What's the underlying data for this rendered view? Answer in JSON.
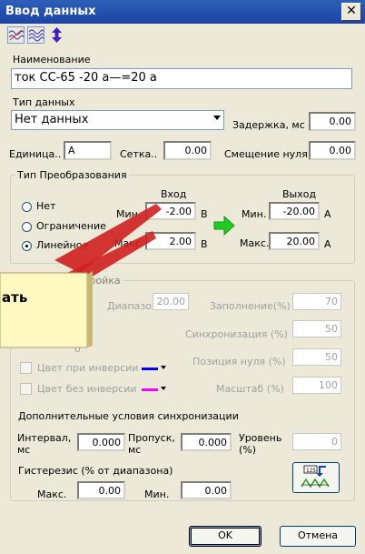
{
  "window": {
    "title": "Ввод данных",
    "close_glyph": "✕"
  },
  "toolbar": {
    "icons": [
      "wave-icon",
      "wave-stack-icon",
      "updown-arrows-icon"
    ]
  },
  "name_section": {
    "label": "Наименование",
    "value": "ток СС-65  -20 а—=20 а"
  },
  "data_type": {
    "label": "Тип данных",
    "value": "Нет данных"
  },
  "delay": {
    "label": "Задержка, мс",
    "value": "0.00"
  },
  "unit": {
    "label": "Единица..",
    "value": "А"
  },
  "grid": {
    "label": "Сетка..",
    "value": "0.00"
  },
  "zero_offset": {
    "label": "Смещение нуля",
    "value": "0.00"
  },
  "conversion": {
    "title": "Тип Преобразования",
    "options": [
      {
        "label": "Нет",
        "selected": false
      },
      {
        "label": "Ограничение",
        "selected": false
      },
      {
        "label": "Линейное",
        "selected": true
      }
    ],
    "input_header": "Вход",
    "output_header": "Выход",
    "min_label": "Мин.",
    "max_label": "Макс.",
    "in_min": "-2.00",
    "in_max": "2.00",
    "in_unit": "В",
    "out_min": "-20.00",
    "out_max": "20.00",
    "out_unit": "А"
  },
  "tooltip": {
    "text": "ать"
  },
  "settings": {
    "title": "настройка",
    "range_label": "Диапазон.",
    "range_value": "20.00",
    "fill_label": "Заполнение(%)",
    "fill_value": "70",
    "sync_label": "Синхронизация (%)",
    "sync_value": "50",
    "zero_pos_label": "Позиция нуля (%)",
    "zero_pos_value": "50",
    "scale_label": "Масштаб (%)",
    "scale_value": "100",
    "inv_color_label": "Цвет при инверсии",
    "inv_color": "#0000ff",
    "noinv_color_label": "Цвет без инверсии",
    "noinv_color": "#ff00ff",
    "partial_1": "ия",
    "partial_2": "б",
    "extra_title": "Дополнительные условия синхронизации",
    "interval_label_1": "Интервал,",
    "interval_label_2": "мс",
    "interval_value": "0.000",
    "skip_label_1": "Пропуск,",
    "skip_label_2": "мс",
    "skip_value": "0.000",
    "level_label_1": "Уровень",
    "level_label_2": "(%)",
    "level_value": "0",
    "hyst_title": "Гистерезис (% от диапазона)",
    "hyst_max_label": "Макс.",
    "hyst_max_value": "0.00",
    "hyst_min_label": "Мин.",
    "hyst_min_value": "0.00",
    "counter_icon_text": "125"
  },
  "buttons": {
    "ok": "OK",
    "cancel": "Отмена"
  },
  "colors": {
    "title_bar": "#1d44a4",
    "arrow": "#22cc22",
    "tooltip_bg": "#fff8c0",
    "callout_line": "#d02020"
  }
}
